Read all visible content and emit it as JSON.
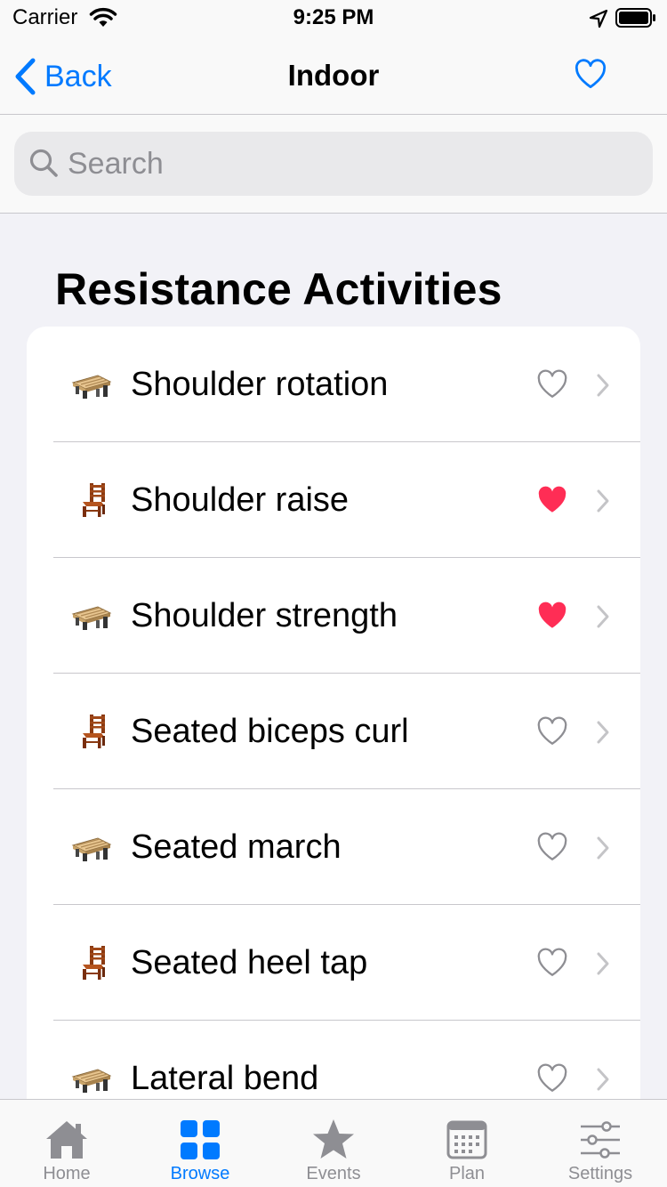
{
  "status": {
    "carrier": "Carrier",
    "time": "9:25 PM"
  },
  "nav": {
    "back_label": "Back",
    "title": "Indoor"
  },
  "search": {
    "placeholder": "Search"
  },
  "section": {
    "title": "Resistance Activities"
  },
  "activities": [
    {
      "label": "Shoulder rotation",
      "icon": "bench-icon",
      "favorite": false
    },
    {
      "label": "Shoulder raise",
      "icon": "chair-icon",
      "favorite": true
    },
    {
      "label": "Shoulder strength",
      "icon": "bench-icon",
      "favorite": true
    },
    {
      "label": "Seated biceps curl",
      "icon": "chair-icon",
      "favorite": false
    },
    {
      "label": "Seated march",
      "icon": "bench-icon",
      "favorite": false
    },
    {
      "label": "Seated heel tap",
      "icon": "chair-icon",
      "favorite": false
    },
    {
      "label": "Lateral bend",
      "icon": "bench-icon",
      "favorite": false
    }
  ],
  "tabs": [
    {
      "label": "Home",
      "icon": "home-icon",
      "active": false
    },
    {
      "label": "Browse",
      "icon": "grid-icon",
      "active": true
    },
    {
      "label": "Events",
      "icon": "star-icon",
      "active": false
    },
    {
      "label": "Plan",
      "icon": "calendar-icon",
      "active": false
    },
    {
      "label": "Settings",
      "icon": "sliders-icon",
      "active": false
    }
  ],
  "colors": {
    "accent": "#007aff",
    "favorite": "#ff2d55",
    "inactive": "#8e8e93",
    "background": "#f2f2f7"
  }
}
